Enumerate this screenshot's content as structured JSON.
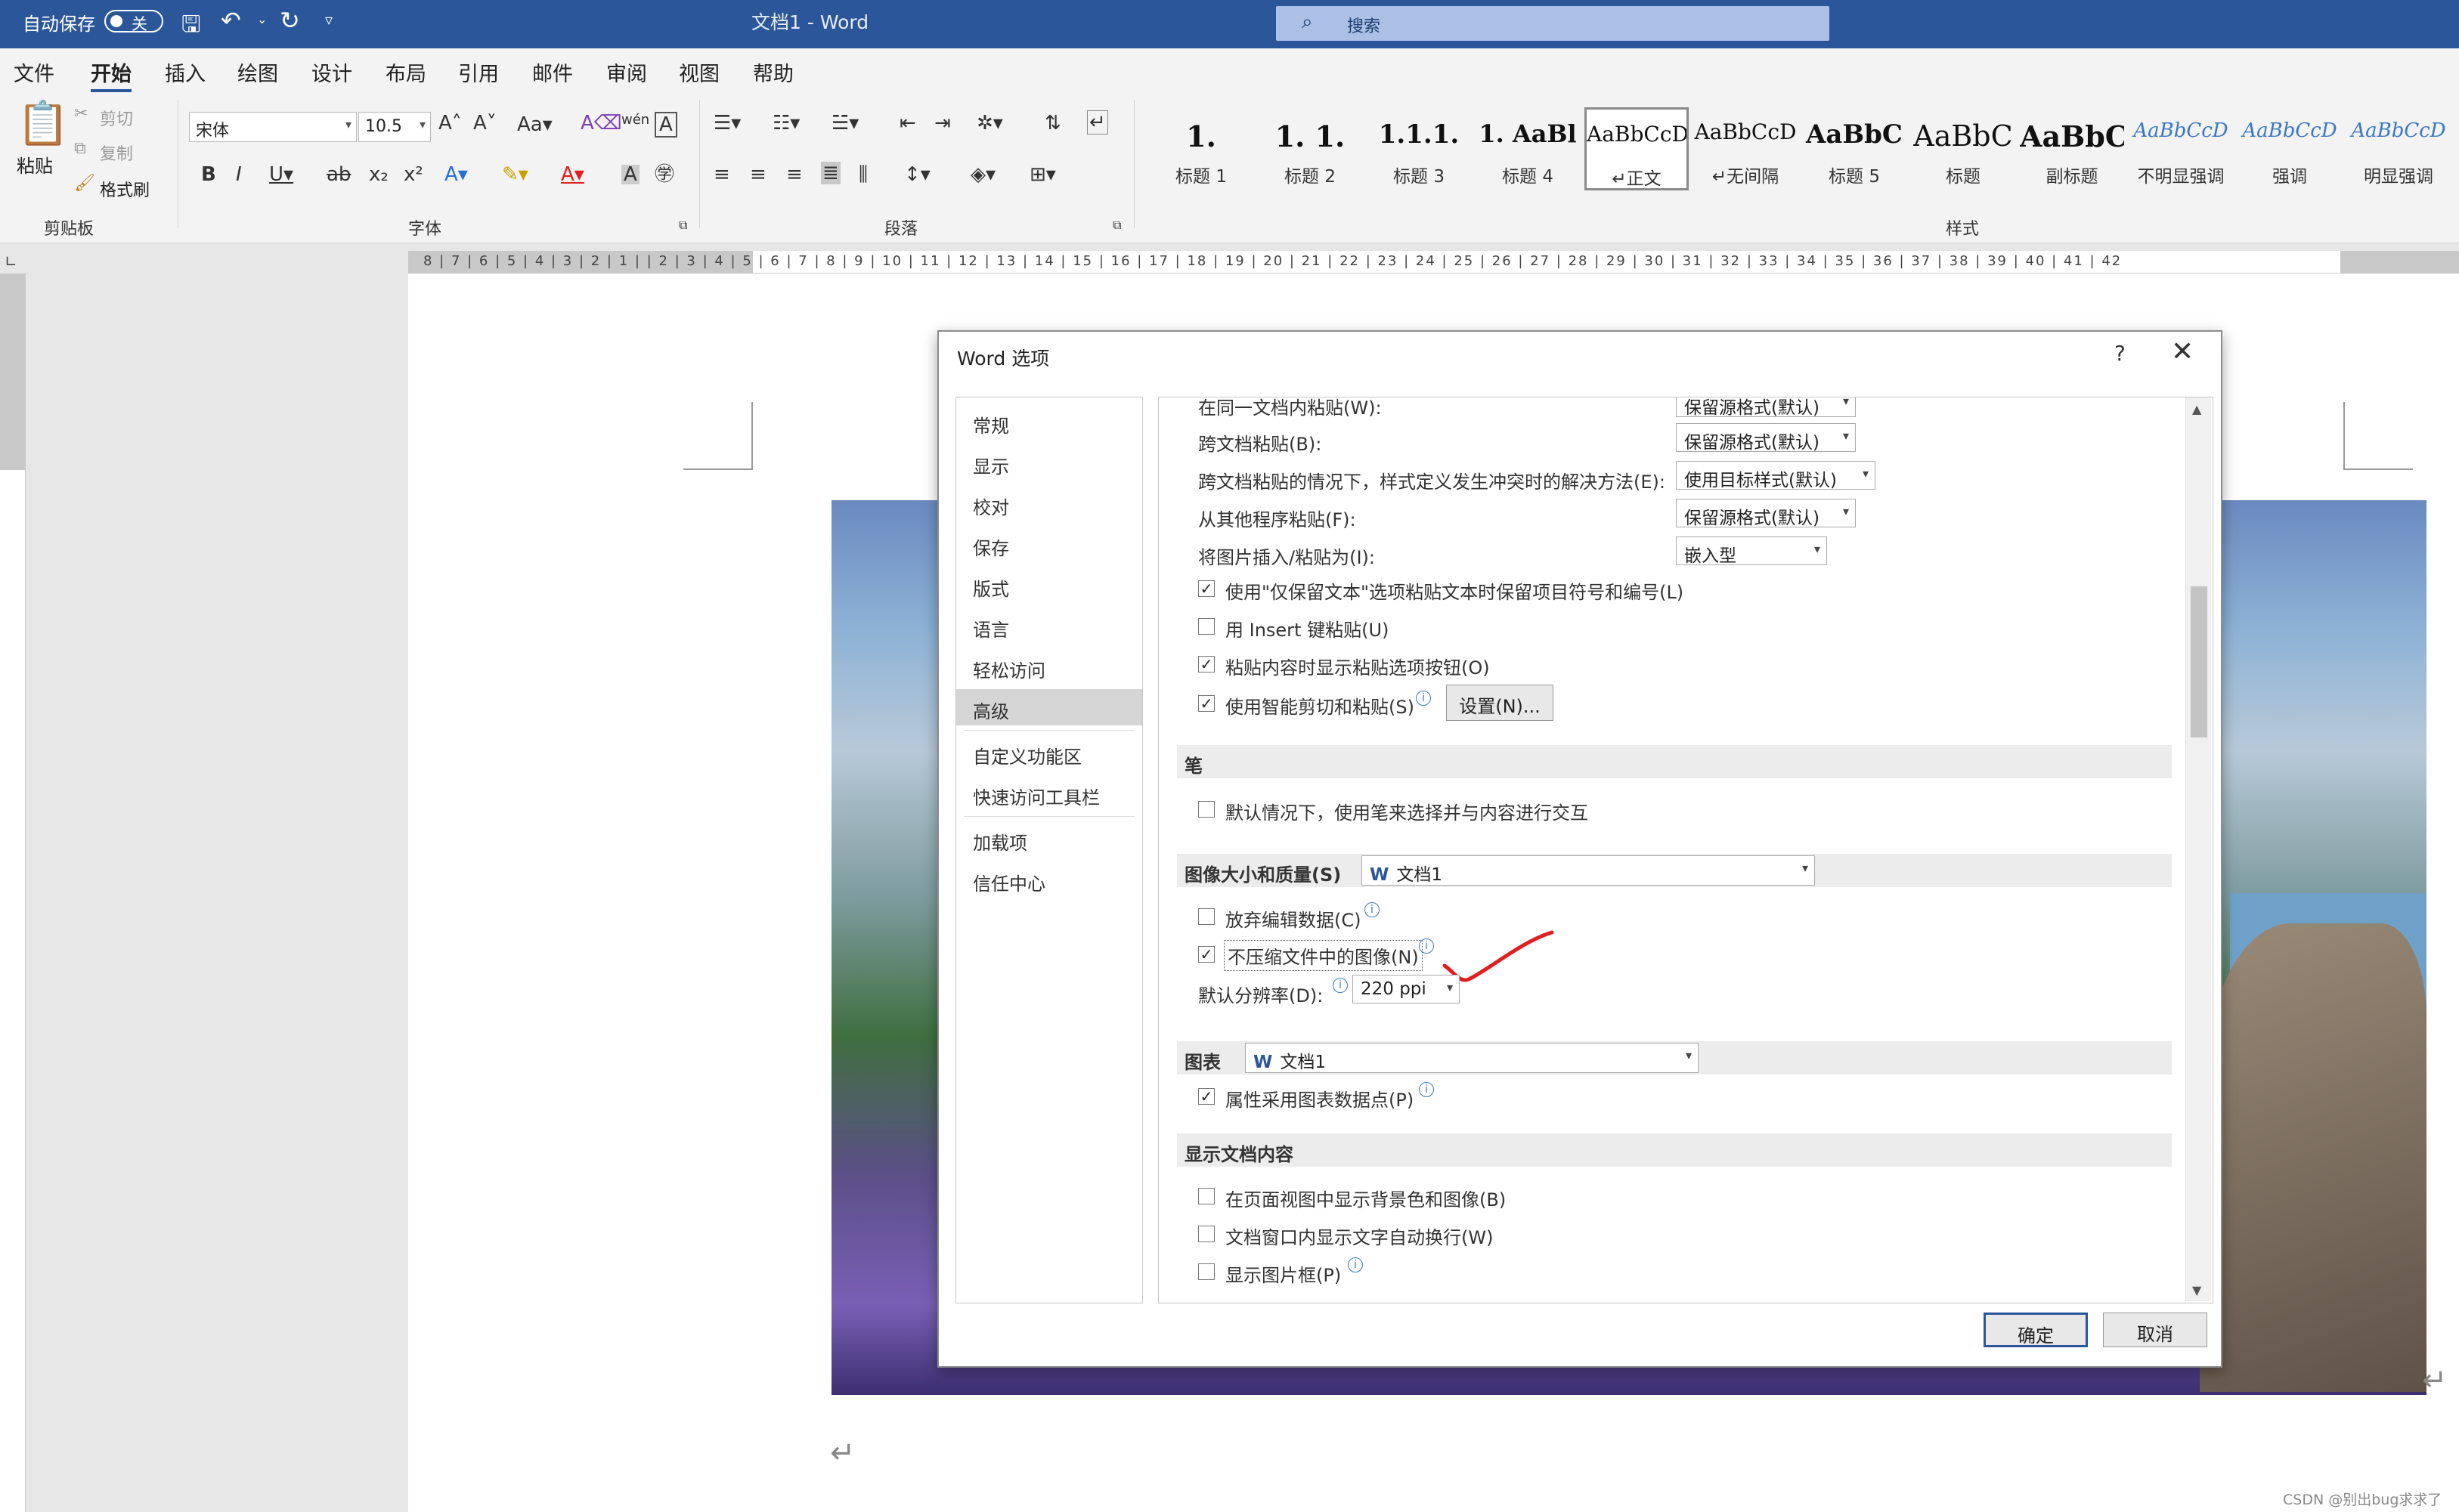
{
  "titlebar": {
    "autosave_label": "自动保存",
    "autosave_state": "关",
    "doc_title": "文档1  -  Word",
    "search_placeholder": "搜索"
  },
  "menu": {
    "tabs": [
      "文件",
      "开始",
      "插入",
      "绘图",
      "设计",
      "布局",
      "引用",
      "邮件",
      "审阅",
      "视图",
      "帮助"
    ],
    "active": "开始"
  },
  "ribbon": {
    "clipboard": {
      "paste": "粘贴",
      "cut": "剪切",
      "copy": "复制",
      "format_painter": "格式刷",
      "group": "剪贴板"
    },
    "font": {
      "name": "宋体",
      "size": "10.5",
      "group": "字体"
    },
    "paragraph": {
      "group": "段落"
    },
    "styles": {
      "group": "样式",
      "items": [
        {
          "sample": "1.",
          "name": "标题 1"
        },
        {
          "sample": "1. 1.",
          "name": "标题 2"
        },
        {
          "sample": "1.1.1.",
          "name": "标题 3"
        },
        {
          "sample": "1. AaBl",
          "name": "标题 4"
        },
        {
          "sample": "AaBbCcD",
          "name": "↵正文"
        },
        {
          "sample": "AaBbCcD",
          "name": "↵无间隔"
        },
        {
          "sample": "AaBbC",
          "name": "标题 5"
        },
        {
          "sample": "AaBbC",
          "name": "标题"
        },
        {
          "sample": "AaBbC",
          "name": "副标题"
        },
        {
          "sample": "AaBbCcD",
          "name": "不明显强调"
        },
        {
          "sample": "AaBbCcD",
          "name": "强调"
        },
        {
          "sample": "AaBbCcD",
          "name": "明显强调"
        }
      ],
      "selected": 4
    }
  },
  "ruler": {
    "numbers": "8 | 7 | 6 | 5 | 4 | 3 | 2 | 1 |   | 2 | 3 | 4 | 5 | 6 | 7 | 8 | 9 | 10 | 11 | 12 | 13 | 14 | 15 | 16 | 17 | 18 | 19 | 20 | 21 | 22 | 23 | 24 | 25 | 26 | 27 | 28 | 29 | 30 | 31 | 32 | 33 | 34 | 35 | 36 | 37 | 38 | 39 | 40 | 41 | 42"
  },
  "dialog": {
    "title": "Word 选项",
    "help": "?",
    "close": "✕",
    "nav": [
      "常规",
      "显示",
      "校对",
      "保存",
      "版式",
      "语言",
      "轻松访问",
      "高级",
      "自定义功能区",
      "快速访问工具栏",
      "加载项",
      "信任中心"
    ],
    "nav_selected": "高级",
    "paste_rows": [
      {
        "label": "在同一文档内粘贴(W):",
        "value": "保留源格式(默认)"
      },
      {
        "label": "跨文档粘贴(B):",
        "value": "保留源格式(默认)"
      },
      {
        "label": "跨文档粘贴的情况下，样式定义发生冲突时的解决方法(E):",
        "value": "使用目标样式(默认)"
      },
      {
        "label": "从其他程序粘贴(F):",
        "value": "保留源格式(默认)"
      },
      {
        "label": "将图片插入/粘贴为(I):",
        "value": "嵌入型"
      }
    ],
    "paste_checks": [
      {
        "label": "使用\"仅保留文本\"选项粘贴文本时保留项目符号和编号(L)",
        "checked": true
      },
      {
        "label": "用 Insert 键粘贴(U)",
        "checked": false
      },
      {
        "label": "粘贴内容时显示粘贴选项按钮(O)",
        "checked": true
      },
      {
        "label": "使用智能剪切和粘贴(S)",
        "checked": true
      }
    ],
    "settings_button": "设置(N)...",
    "pen_section": "笔",
    "pen_check": {
      "label": "默认情况下，使用笔来选择并与内容进行交互",
      "checked": false
    },
    "image_section": "图像大小和质量(S)",
    "image_doc": "文档1",
    "image_checks": [
      {
        "label": "放弃编辑数据(C)",
        "checked": false
      },
      {
        "label": "不压缩文件中的图像(N)",
        "checked": true
      }
    ],
    "resolution_label": "默认分辨率(D):",
    "resolution_value": "220 ppi",
    "chart_section": "图表",
    "chart_doc": "文档1",
    "chart_check": {
      "label": "属性采用图表数据点(P)",
      "checked": true
    },
    "display_section": "显示文档内容",
    "display_checks": [
      {
        "label": "在页面视图中显示背景色和图像(B)",
        "checked": false
      },
      {
        "label": "文档窗口内显示文字自动换行(W)",
        "checked": false
      },
      {
        "label": "显示图片框(P)",
        "checked": false
      }
    ],
    "ok": "确定",
    "cancel": "取消"
  },
  "watermark": "CSDN @别出bug求求了",
  "colors": {
    "accent": "#2b579a",
    "annotation": "#e02020"
  }
}
